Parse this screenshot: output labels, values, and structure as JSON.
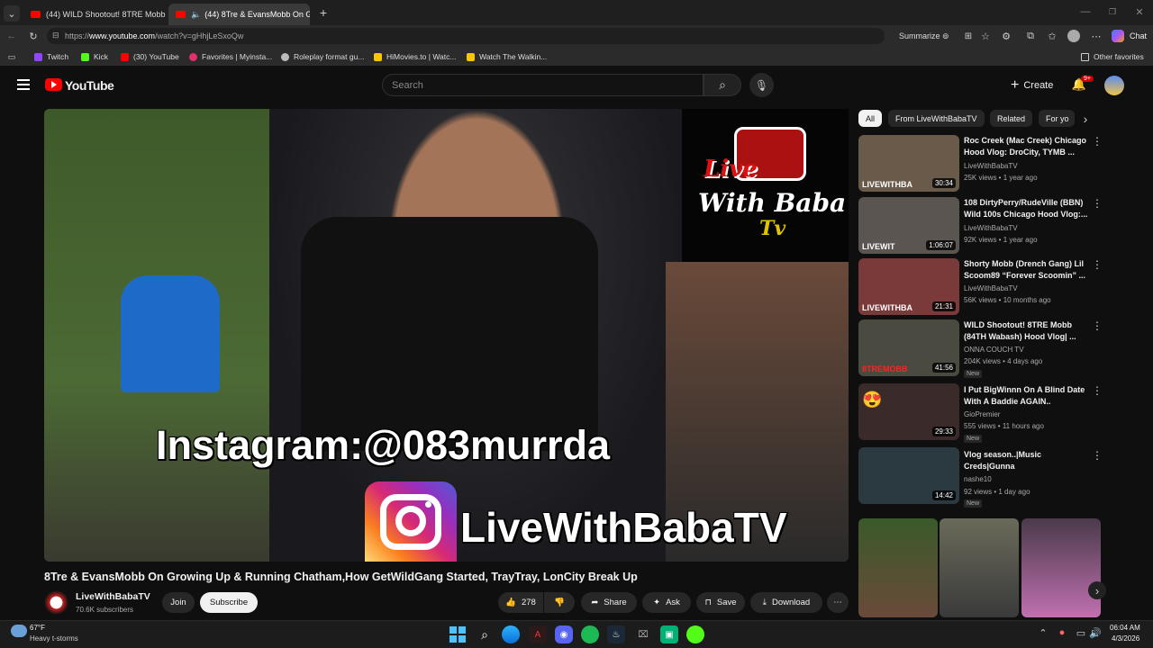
{
  "browser": {
    "tabs": [
      {
        "label": "(44) WILD Shootout! 8TRE Mobb (",
        "close": "✕"
      },
      {
        "label": "(44) 8Tre & EvansMobb On G",
        "close": "✕"
      }
    ],
    "new_tab": "+",
    "url_prefix": "https://",
    "url_host": "www.youtube.com",
    "url_path": "/watch?v=gHhjLeSxoQw",
    "summarize": "Summarize",
    "chat": "Chat",
    "favorites": [
      {
        "label": "Twitch",
        "color": "#9146ff"
      },
      {
        "label": "Kick",
        "color": "#53fc18"
      },
      {
        "label": "(30) YouTube",
        "color": "#ff0000"
      },
      {
        "label": "Favorites | Myinsta...",
        "color": "#e1306c"
      },
      {
        "label": "Roleplay format gu...",
        "color": "#bbbbbb"
      },
      {
        "label": "HiMovies.to | Watc...",
        "color": "#f7c600"
      },
      {
        "label": "Watch The Walkin...",
        "color": "#f7c600"
      }
    ],
    "other_favorites": "Other favorites"
  },
  "youtube": {
    "logo": "YouTube",
    "search_placeholder": "Search",
    "create": "Create",
    "notif_count": "9+",
    "video_overlay_instagram": "Instagram:@083murrda",
    "video_overlay_channel": "LiveWithBabaTV",
    "logo_line1": "Live",
    "logo_line2": "With Baba",
    "logo_line3": "Tv",
    "title": "8Tre & EvansMobb On Growing Up & Running Chatham,How GetWildGang Started, TrayTray, LonCity Break Up",
    "channel": "LiveWithBabaTV",
    "subscribers": "70.6K subscribers",
    "join": "Join",
    "subscribe": "Subscribe",
    "likes": "278",
    "share": "Share",
    "ask": "Ask",
    "save": "Save",
    "download": "Download",
    "chips": [
      "All",
      "From LiveWithBabaTV",
      "Related",
      "For yo"
    ],
    "recommended": [
      {
        "title": "Roc Creek (Mac Creek) Chicago Hood Vlog: DroCity, TYMB ...",
        "channel": "LiveWithBabaTV",
        "meta": "25K views • 1 year ago",
        "duration": "30:34",
        "thumb_text": "LIVEWITHBA",
        "badge": "",
        "color": "#6a5a4a"
      },
      {
        "title": "108 DirtyPerry/RudeVille (BBN) Wild 100s Chicago Hood Vlog:...",
        "channel": "LiveWithBabaTV",
        "meta": "92K views • 1 year ago",
        "duration": "1:06:07",
        "thumb_text": "LIVEWIT",
        "badge": "",
        "color": "#5a5550"
      },
      {
        "title": "Shorty Mobb (Drench Gang) Lil Scoom89 “Forever Scoomin” ...",
        "channel": "LiveWithBabaTV",
        "meta": "56K views • 10 months ago",
        "duration": "21:31",
        "thumb_text": "LIVEWITHBA",
        "badge": "",
        "color": "#7a3a3a"
      },
      {
        "title": "WILD Shootout! 8TRE Mobb (84TH Wabash) Hood Vlog| ...",
        "channel": "ONNA COUCH TV",
        "meta": "204K views • 4 days ago",
        "duration": "41:56",
        "thumb_text": "8TREMOBB",
        "badge": "New",
        "color": "#4a4a40"
      },
      {
        "title": "I Put BigWinnn On A Blind Date With A Baddie AGAIN..",
        "channel": "GioPremier",
        "meta": "555 views • 11 hours ago",
        "duration": "29:33",
        "thumb_text": "",
        "badge": "New",
        "color": "#3a2a2a"
      },
      {
        "title": "Vlog season..|Music Creds|Gunna",
        "channel": "nashe10",
        "meta": "92 views • 1 day ago",
        "duration": "14:42",
        "thumb_text": "",
        "badge": "New",
        "color": "#2a3a40"
      }
    ]
  },
  "taskbar": {
    "weather_temp": "67°F",
    "weather_desc": "Heavy t-storms",
    "time": "06:04 AM",
    "date": "4/3/2026"
  }
}
